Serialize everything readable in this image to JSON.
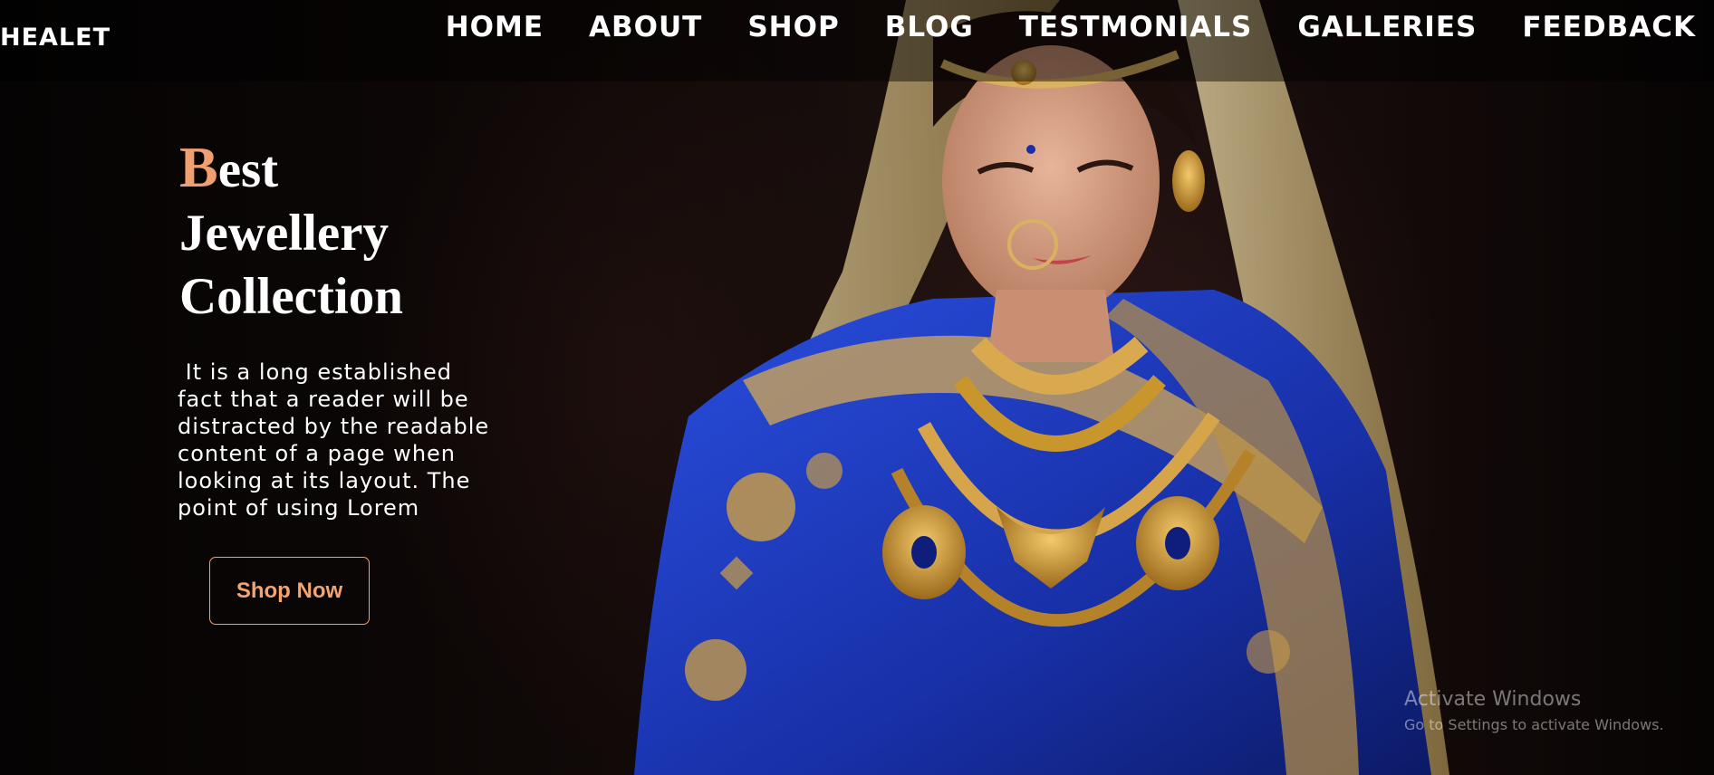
{
  "brand": {
    "name": "HEALET"
  },
  "nav": {
    "items": [
      {
        "label": "HOME"
      },
      {
        "label": "ABOUT"
      },
      {
        "label": "SHOP"
      },
      {
        "label": "BLOG"
      },
      {
        "label": "TESTMONIALS"
      },
      {
        "label": "GALLERIES"
      },
      {
        "label": "FEEDBACK"
      }
    ]
  },
  "hero": {
    "title_initial": "B",
    "title_line1_rest": "est",
    "title_line2": "Jewellery",
    "title_line3": "Collection",
    "description": " It is a long established fact that a reader will be distracted by the readable content of a page when looking at its layout. The point of using Lorem",
    "button_label": "Shop Now",
    "image_alt": "Bride in blue silk saree with gold jewellery"
  },
  "watermark": {
    "line1": "Activate Windows",
    "line2": "Go to Settings to activate Windows."
  },
  "colors": {
    "accent": "#f0a070",
    "background": "#0b0706",
    "saree_blue": "#1f3fc4",
    "gold": "#c9962e"
  }
}
